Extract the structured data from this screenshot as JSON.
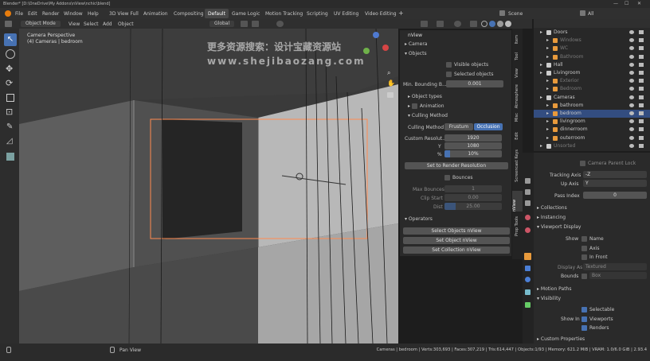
{
  "title": "Blender* [D:\\OneDrive\\My Addons\\nView\\nchic\\blend]",
  "menu": [
    "File",
    "Edit",
    "Render",
    "Window",
    "Help"
  ],
  "workspaces": [
    "3D View Full",
    "Animation",
    "Compositing",
    "Default",
    "Game Logic",
    "Motion Tracking",
    "Scripting",
    "UV Editing",
    "Video Editing"
  ],
  "workspace_active": "Default",
  "scene": "Scene",
  "view_layer": "All",
  "header": {
    "mode": "Object Mode",
    "menus": [
      "View",
      "Select",
      "Add",
      "Object"
    ],
    "orientation": "Global"
  },
  "viewport": {
    "title": "Camera Perspective",
    "subtitle": "(4) Cameras | bedroom"
  },
  "watermark": {
    "line1": "更多资源搜索：设计宝藏资源站",
    "line2": "www.shejibaozang.com"
  },
  "nview": {
    "title": "nView",
    "camera": "Camera",
    "objects": "Objects",
    "visible_objects": "Visible objects",
    "selected_objects": "Selected objects",
    "min_bounding_label": "Min. Bounding B...",
    "min_bounding_value": "0.001",
    "object_types": "Object types",
    "animation": "Animation",
    "culling_method_section": "Culling Method",
    "culling_method_label": "Culling Method",
    "frustum": "Frustum",
    "occlusion": "Occlusion",
    "custom_resolution": "Custom Resolut...",
    "res_x": "1920",
    "y_label": "Y",
    "res_y": "1080",
    "percent_label": "%",
    "res_percent": "10%",
    "set_render_res": "Set to Render Resolution",
    "bounces": "Bounces",
    "max_bounces_label": "Max Bounces",
    "max_bounces_value": "1",
    "clip_start_label": "Clip Start",
    "clip_start_value": "0.00",
    "dist_label": "Dist",
    "dist_value": "25.00",
    "operators": "Operators",
    "select_objects": "Select Objects nView",
    "set_objects": "Set Object nView",
    "set_collection": "Set Collection nView"
  },
  "side_tabs": [
    "Item",
    "Tool",
    "View",
    "Atmosphere",
    "Misc",
    "Edit",
    "Screencast Keys",
    "nView",
    "Prop Tools"
  ],
  "outliner": [
    {
      "name": "Doors",
      "depth": 0,
      "dim": false
    },
    {
      "name": "Windows",
      "depth": 1,
      "dim": true
    },
    {
      "name": "WC",
      "depth": 1,
      "dim": true
    },
    {
      "name": "Bathroom",
      "depth": 1,
      "dim": true
    },
    {
      "name": "Hall",
      "depth": 0,
      "dim": false
    },
    {
      "name": "Livingroom",
      "depth": 0,
      "dim": false
    },
    {
      "name": "Exterior",
      "depth": 1,
      "dim": true
    },
    {
      "name": "Bedroom",
      "depth": 1,
      "dim": true
    },
    {
      "name": "Cameras",
      "depth": 0,
      "dim": false
    },
    {
      "name": "bathroom",
      "depth": 1,
      "dim": false
    },
    {
      "name": "bedroom",
      "depth": 1,
      "dim": false,
      "selected": true
    },
    {
      "name": "livingroom",
      "depth": 1,
      "dim": false
    },
    {
      "name": "dinnerroom",
      "depth": 1,
      "dim": false
    },
    {
      "name": "outerroom",
      "depth": 1,
      "dim": false
    },
    {
      "name": "Unsorted",
      "depth": 0,
      "dim": true
    }
  ],
  "props": {
    "camera_parent_lock": "Camera Parent Lock",
    "tracking_axis_label": "Tracking Axis",
    "tracking_axis_value": "-Z",
    "up_axis_label": "Up Axis",
    "up_axis_value": "Y",
    "pass_index_label": "Pass Index",
    "pass_index_value": "0",
    "collections": "Collections",
    "instancing": "Instancing",
    "viewport_display": "Viewport Display",
    "show_label": "Show",
    "name": "Name",
    "axis": "Axis",
    "in_front": "In Front",
    "display_as_label": "Display As",
    "display_as_value": "Textured",
    "bounds_label": "Bounds",
    "bounds_value": "Box",
    "motion_paths": "Motion Paths",
    "visibility": "Visibility",
    "selectable": "Selectable",
    "show_in_label": "Show In",
    "viewports": "Viewports",
    "renders": "Renders",
    "custom_properties": "Custom Properties"
  },
  "status": {
    "pan_view": "Pan View",
    "info": "Cameras | bedroom | Verts:303,693 | Faces:307,219 | Tris:614,447 | Objects:1/93 | Memory: 621.2 MiB | VRAM: 1.0/6.0 GiB | 2.93.4"
  }
}
